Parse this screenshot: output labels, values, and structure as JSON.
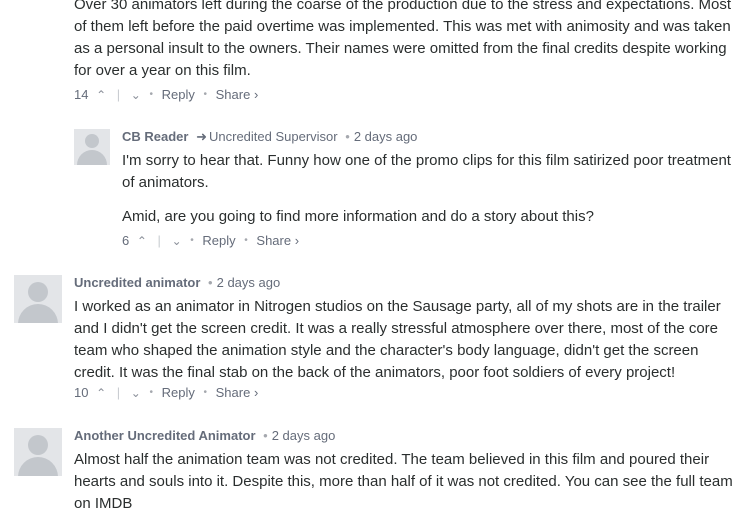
{
  "comments": [
    {
      "body": "Over 30 animators left during the coarse of the production due to the stress and expectations. Most of them left before the paid overtime was implemented. This was met with animosity and was taken as a personal insult to the owners. Their names were omitted from the final credits despite working for over a year on this film.",
      "upvotes": "14",
      "reply_label": "Reply",
      "share_label": "Share ›"
    },
    {
      "author": "CB Reader",
      "reply_to": "Uncredited Supervisor",
      "time": "2 days ago",
      "body_p1": "I'm sorry to hear that. Funny how one of the promo clips for this film satirized poor treatment of animators.",
      "body_p2": "Amid, are you going to find more information and do a story about this?",
      "upvotes": "6",
      "reply_label": "Reply",
      "share_label": "Share ›"
    },
    {
      "author": "Uncredited animator",
      "time": "2 days ago",
      "body": "I worked as an animator in Nitrogen studios on the Sausage party, all of my shots are in the trailer and I didn't get the screen credit. It was a really stressful atmosphere over there, most of the core team who shaped the animation style and the character's body language, didn't get the screen credit. It was the final stab on the back of the animators, poor foot soldiers of every project!",
      "upvotes": "10",
      "reply_label": "Reply",
      "share_label": "Share ›"
    },
    {
      "author": "Another Uncredited Animator",
      "time": "2 days ago",
      "body": "Almost half the animation team was not credited. The team believed in this film and poured their hearts and souls into it. Despite this, more than half of it was not credited. You can see the full team on IMDB"
    }
  ]
}
